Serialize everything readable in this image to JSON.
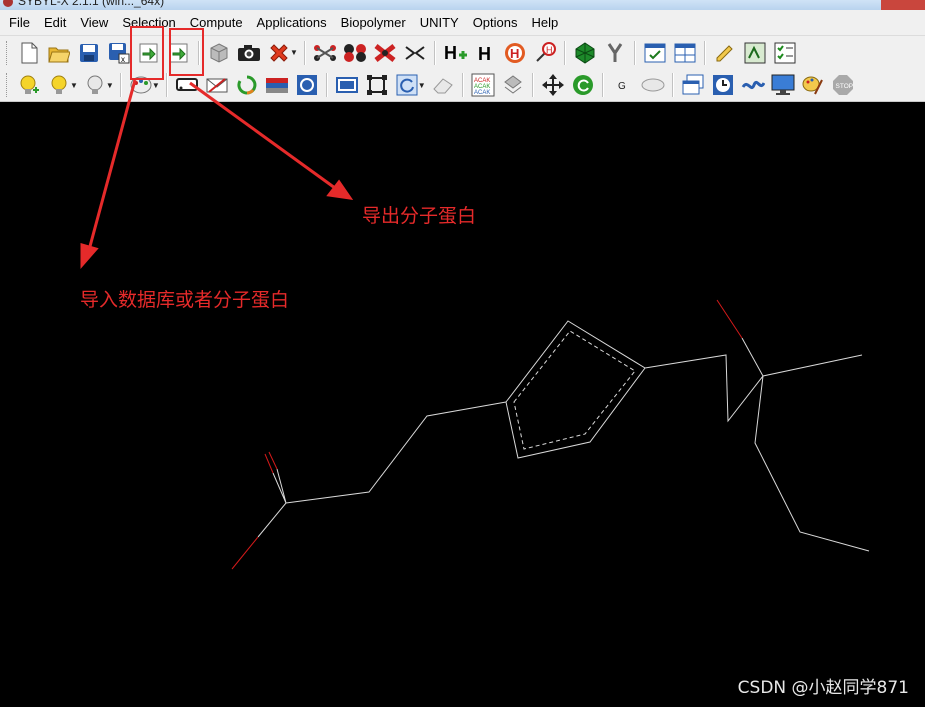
{
  "window": {
    "title": "SYBYL-X 2.1.1 (win..._64x)"
  },
  "menu": {
    "items": [
      "File",
      "Edit",
      "View",
      "Selection",
      "Compute",
      "Applications",
      "Biopolymer",
      "UNITY",
      "Options",
      "Help"
    ]
  },
  "toolbar1": {
    "buttons": [
      "new-document-icon",
      "open-folder-icon",
      "save-disk-icon",
      "save-as-disk-icon",
      "import-icon",
      "export-icon",
      "cube-icon",
      "camera-icon",
      "delete-x-icon",
      "molecule-link-icon",
      "molecule-fill-icon",
      "molecule-cross-icon",
      "bond-break-icon",
      "add-hydrogen-icon",
      "hydrogen-icon",
      "hydrogen-circle-icon",
      "hydrogen-key-icon",
      "gem-icon",
      "fork-icon",
      "window-check-icon",
      "window-grid-icon",
      "pencil-note-icon",
      "fit-icon",
      "checklist-icon"
    ]
  },
  "toolbar2": {
    "buttons": [
      "bulb-add-icon",
      "bulb-yellow-icon",
      "bulb-gray-icon",
      "palette-icon",
      "label-icon",
      "envelope-icon",
      "recycle-icon",
      "ribbon-icon",
      "cycle-icon",
      "select-rect-icon",
      "select-box-icon",
      "refresh-icon",
      "eraser-icon",
      "sequence-icon",
      "stack-icon",
      "move-arrows-icon",
      "rotate-green-icon",
      "g-label-icon",
      "mouse-icon",
      "windows-icon",
      "clock-icon",
      "link-chain-icon",
      "monitor-icon",
      "paint-icon",
      "stop-icon"
    ]
  },
  "annotations": {
    "export_label": "导出分子蛋白",
    "import_label": "导入数据库或者分子蛋白"
  },
  "colors": {
    "annotation": "#e52a2a",
    "canvas_bg": "#000000",
    "bond": "#d9d9d9",
    "oxygen_bond": "#d41a1a"
  },
  "watermark": "CSDN @小赵同学871"
}
